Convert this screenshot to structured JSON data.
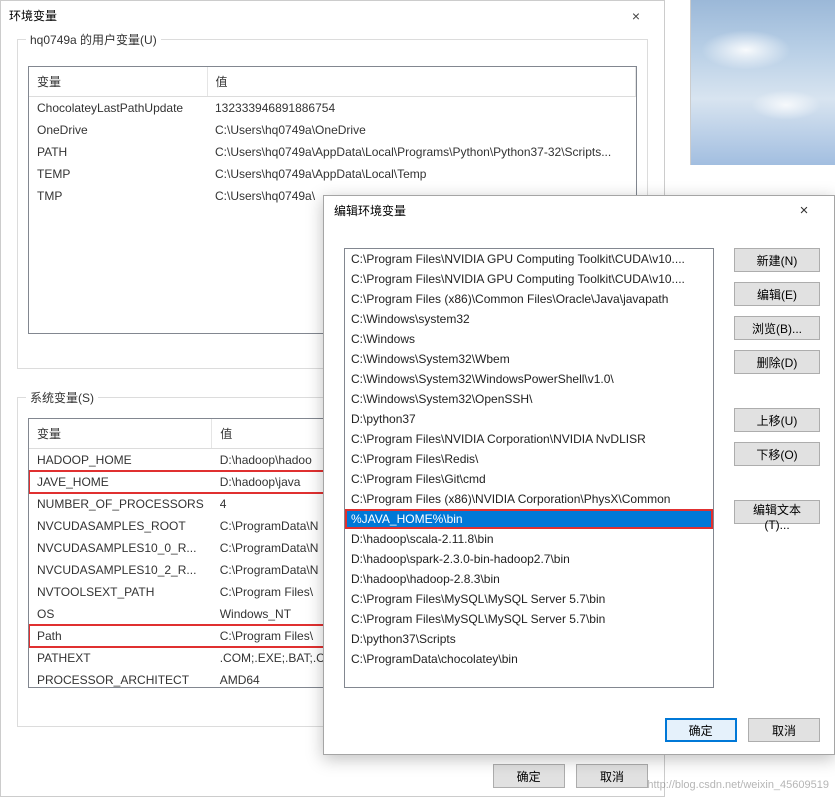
{
  "bg": {
    "watermark": "http://blog.csdn.net/weixin_45609519"
  },
  "dlg1": {
    "title": "环境变量",
    "close": "×",
    "userGroup": "hq0749a 的用户变量(U)",
    "sysGroup": "系统变量(S)",
    "headers": {
      "var": "变量",
      "val": "值"
    },
    "userVars": [
      {
        "var": "ChocolateyLastPathUpdate",
        "val": "132333946891886754"
      },
      {
        "var": "OneDrive",
        "val": "C:\\Users\\hq0749a\\OneDrive"
      },
      {
        "var": "PATH",
        "val": "C:\\Users\\hq0749a\\AppData\\Local\\Programs\\Python\\Python37-32\\Scripts..."
      },
      {
        "var": "TEMP",
        "val": "C:\\Users\\hq0749a\\AppData\\Local\\Temp"
      },
      {
        "var": "TMP",
        "val": "C:\\Users\\hq0749a\\"
      }
    ],
    "sysVars": [
      {
        "var": "HADOOP_HOME",
        "val": "D:\\hadoop\\hadoo"
      },
      {
        "var": "JAVE_HOME",
        "val": "D:\\hadoop\\java",
        "hl": true
      },
      {
        "var": "NUMBER_OF_PROCESSORS",
        "val": "4"
      },
      {
        "var": "NVCUDASAMPLES_ROOT",
        "val": "C:\\ProgramData\\N"
      },
      {
        "var": "NVCUDASAMPLES10_0_R...",
        "val": "C:\\ProgramData\\N"
      },
      {
        "var": "NVCUDASAMPLES10_2_R...",
        "val": "C:\\ProgramData\\N"
      },
      {
        "var": "NVTOOLSEXT_PATH",
        "val": "C:\\Program Files\\"
      },
      {
        "var": "OS",
        "val": "Windows_NT"
      },
      {
        "var": "Path",
        "val": "C:\\Program Files\\",
        "hl": true
      },
      {
        "var": "PATHEXT",
        "val": ".COM;.EXE;.BAT;.CI"
      },
      {
        "var": "PROCESSOR_ARCHITECT",
        "val": "AMD64"
      }
    ],
    "buttons": {
      "ok": "确定",
      "cancel": "取消"
    }
  },
  "dlg2": {
    "title": "编辑环境变量",
    "close": "×",
    "items": [
      "C:\\Program Files\\NVIDIA GPU Computing Toolkit\\CUDA\\v10....",
      "C:\\Program Files\\NVIDIA GPU Computing Toolkit\\CUDA\\v10....",
      "C:\\Program Files (x86)\\Common Files\\Oracle\\Java\\javapath",
      "C:\\Windows\\system32",
      "C:\\Windows",
      "C:\\Windows\\System32\\Wbem",
      "C:\\Windows\\System32\\WindowsPowerShell\\v1.0\\",
      "C:\\Windows\\System32\\OpenSSH\\",
      "D:\\python37",
      "C:\\Program Files\\NVIDIA Corporation\\NVIDIA NvDLISR",
      "C:\\Program Files\\Redis\\",
      "C:\\Program Files\\Git\\cmd",
      "C:\\Program Files (x86)\\NVIDIA Corporation\\PhysX\\Common",
      "%JAVA_HOME%\\bin",
      "D:\\hadoop\\scala-2.11.8\\bin",
      "D:\\hadoop\\spark-2.3.0-bin-hadoop2.7\\bin",
      "D:\\hadoop\\hadoop-2.8.3\\bin",
      "C:\\Program Files\\MySQL\\MySQL Server 5.7\\bin",
      "C:\\Program Files\\MySQL\\MySQL Server 5.7\\bin",
      "D:\\python37\\Scripts",
      "C:\\ProgramData\\chocolatey\\bin"
    ],
    "selectedIndex": 13,
    "buttons": {
      "new": "新建(N)",
      "edit": "编辑(E)",
      "browse": "浏览(B)...",
      "delete": "删除(D)",
      "up": "上移(U)",
      "down": "下移(O)",
      "editText": "编辑文本(T)...",
      "ok": "确定",
      "cancel": "取消"
    }
  }
}
